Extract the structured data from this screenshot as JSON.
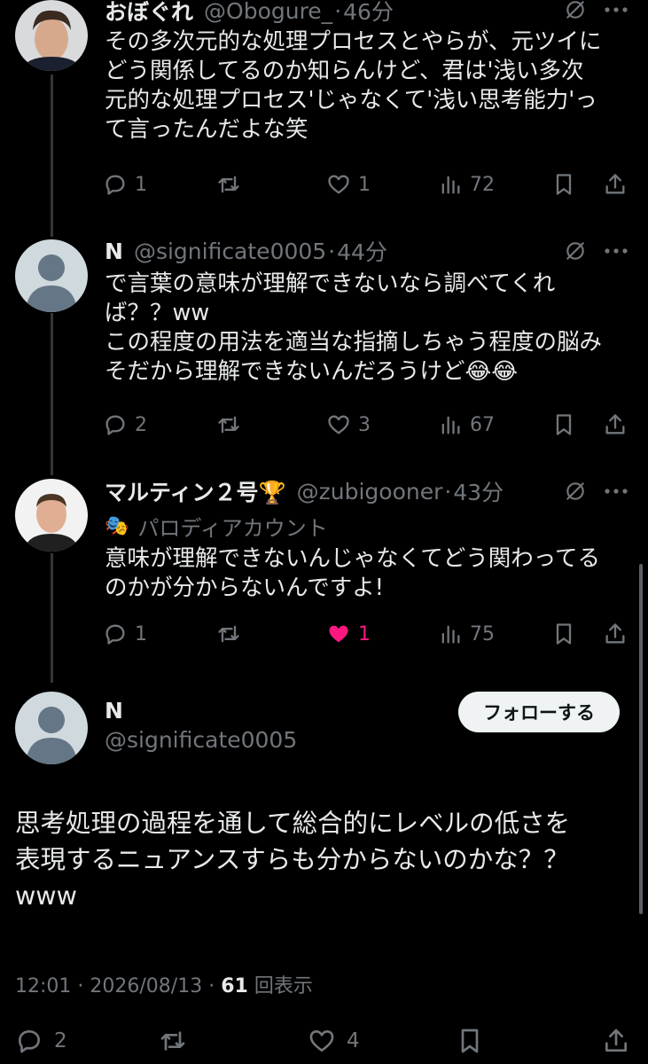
{
  "replies": [
    {
      "name": "おぼぐれ",
      "handle": "@Obogure_",
      "time": "46分",
      "body": "その多次元的な処理プロセスとやらが、元ツイに\nどう関係してるのか知らんけど、君は'浅い多次\n元的な処理プロセス'じゃなくて'浅い思考能力'っ\nて言ったんだよな笑",
      "replies": "1",
      "likes": "1",
      "views": "72"
    },
    {
      "name": "N",
      "handle": "@significate0005",
      "time": "44分",
      "body": "で言葉の意味が理解できないなら調べてくれ\nば？？ww\nこの程度の用法を適当な指摘しちゃう程度の脳み\nそだから理解できないんだろうけど😂😂",
      "replies": "2",
      "likes": "3",
      "views": "67"
    },
    {
      "name": "マルティン２号🏆",
      "handle": "@zubigooner",
      "time": "43分",
      "parody": "パロディアカウント",
      "body": "意味が理解できないんじゃなくてどう関わってる\nのかが分からないんですよ!",
      "replies": "1",
      "likes": "1",
      "views": "75"
    }
  ],
  "main": {
    "name": "N",
    "handle": "@significate0005",
    "follow_label": "フォローする",
    "body": "思考処理の過程を通して総合的にレベルの低さを\n表現するニュアンスすらも分からないのかな？？\nwww",
    "time": "12:01",
    "date": "2026/08/13",
    "views_count": "61",
    "views_label": "回表示",
    "replies": "2",
    "likes": "4"
  },
  "colors": {
    "background": "#000000",
    "text": "#e7e9ea",
    "muted": "#71767b",
    "like_active": "#f91880"
  }
}
